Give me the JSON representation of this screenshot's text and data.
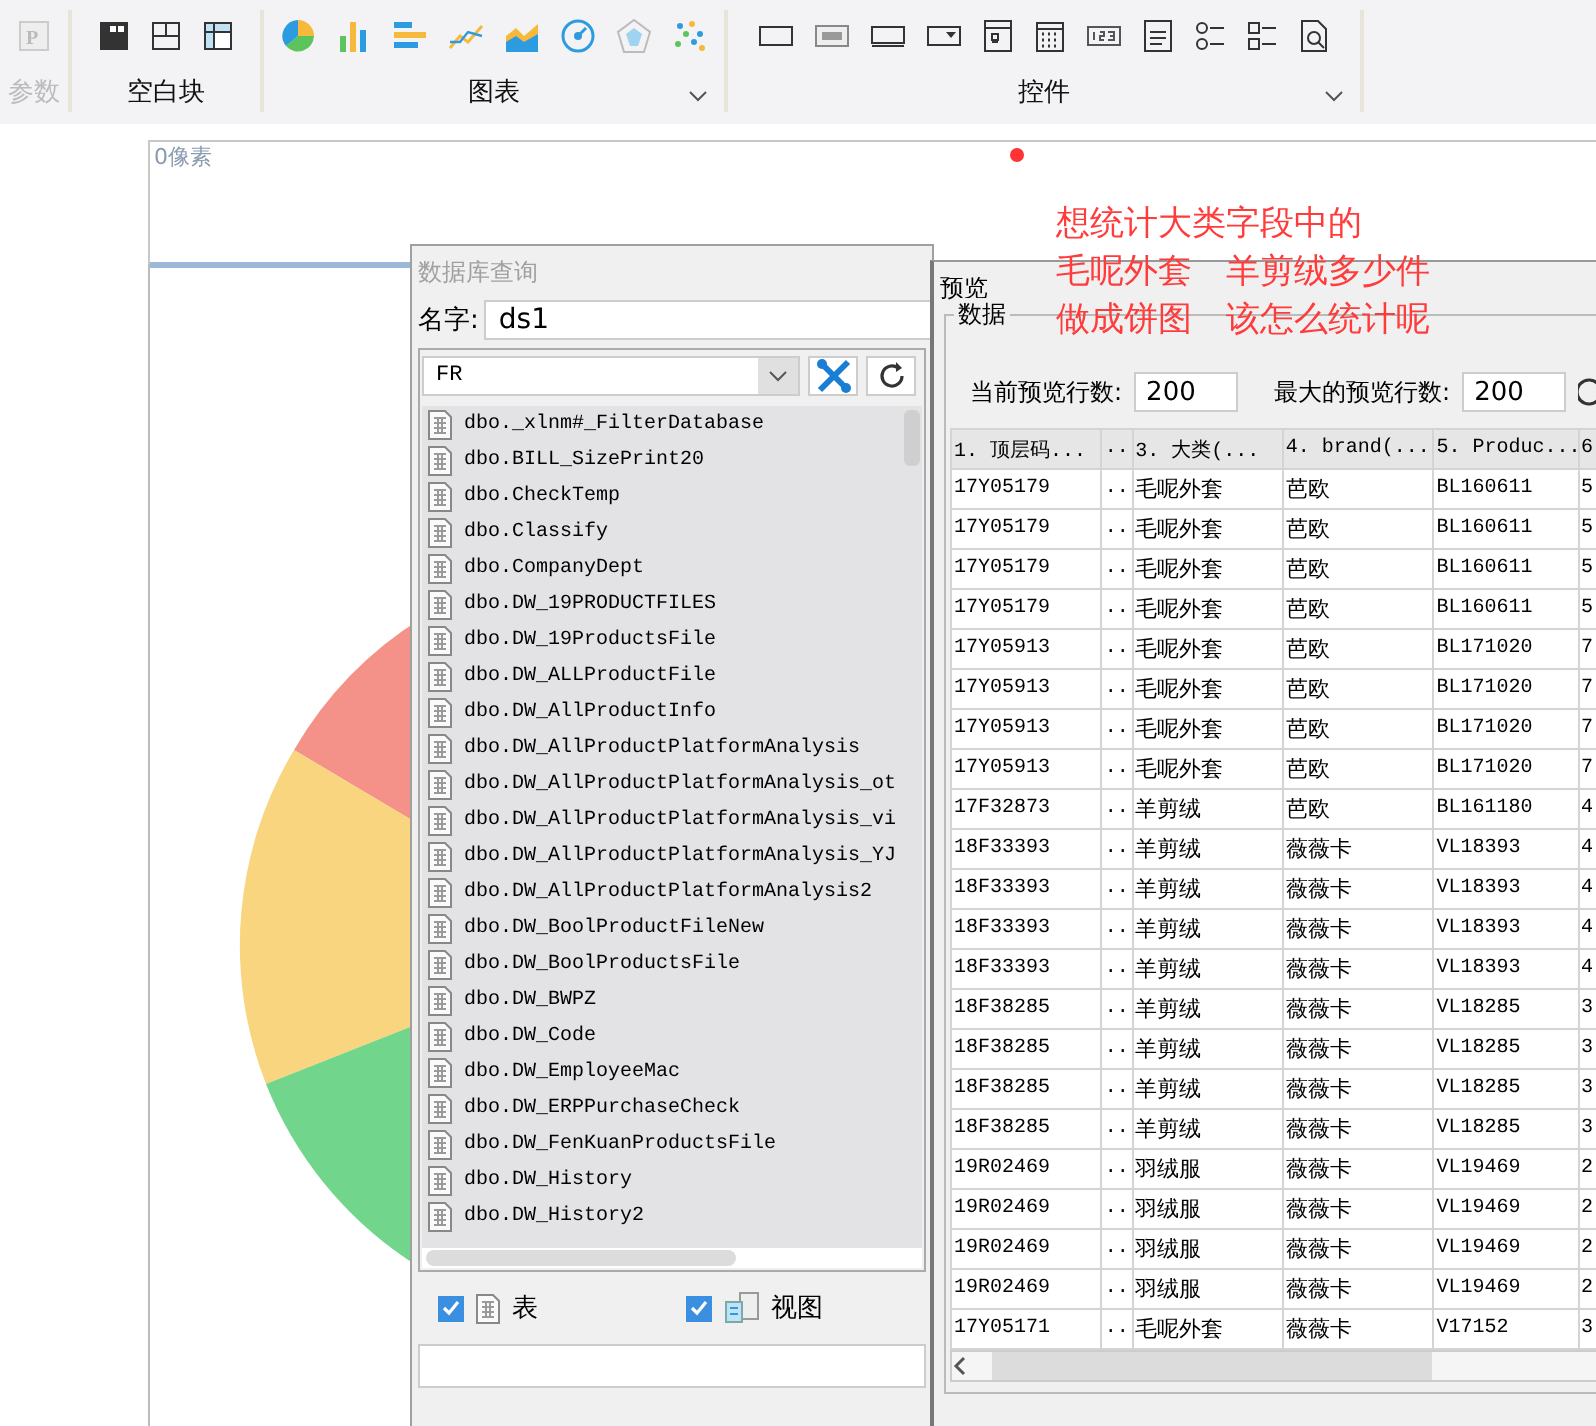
{
  "toolbar": {
    "groups": [
      {
        "label": "参数",
        "disabled": true,
        "dropdown": false,
        "icon_text": "P"
      },
      {
        "label": "空白块",
        "disabled": false,
        "dropdown": false
      },
      {
        "label": "图表",
        "disabled": false,
        "dropdown": true
      },
      {
        "label": "控件",
        "disabled": false,
        "dropdown": true
      }
    ]
  },
  "canvas": {
    "ruler_label": "0像素"
  },
  "annotation": {
    "lines": [
      "想统计大类字段中的",
      "毛呢外套　羊剪绒多少件",
      "做成饼图　该怎么统计呢"
    ]
  },
  "db_dialog": {
    "title": "数据库查询",
    "name_label": "名字:",
    "name_value": "ds1",
    "connection": "FR",
    "tables": [
      "dbo._xlnm#_FilterDatabase",
      "dbo.BILL_SizePrint20",
      "dbo.CheckTemp",
      "dbo.Classify",
      "dbo.CompanyDept",
      "dbo.DW_19PRODUCTFILES",
      "dbo.DW_19ProductsFile",
      "dbo.DW_ALLProductFile",
      "dbo.DW_AllProductInfo",
      "dbo.DW_AllProductPlatformAnalysis",
      "dbo.DW_AllProductPlatformAnalysis_ot",
      "dbo.DW_AllProductPlatformAnalysis_vi",
      "dbo.DW_AllProductPlatformAnalysis_YJ",
      "dbo.DW_AllProductPlatformAnalysis2",
      "dbo.DW_BoolProductFileNew",
      "dbo.DW_BoolProductsFile",
      "dbo.DW_BWPZ",
      "dbo.DW_Code",
      "dbo.DW_EmployeeMac",
      "dbo.DW_ERPPurchaseCheck",
      "dbo.DW_FenKuanProductsFile",
      "dbo.DW_History",
      "dbo.DW_History2"
    ],
    "filters": [
      {
        "label": "表",
        "checked": true,
        "kind": "table"
      },
      {
        "label": "视图",
        "checked": true,
        "kind": "view"
      }
    ]
  },
  "preview": {
    "title": "预览",
    "group_label": "数据",
    "current_rows_label": "当前预览行数:",
    "current_rows": "200",
    "max_rows_label": "最大的预览行数:",
    "max_rows": "200",
    "columns": [
      "1. 顶层码...",
      "..",
      "3. 大类(...",
      "4. brand(...",
      "5. Produc...",
      "6"
    ],
    "rows": [
      [
        "17Y05179",
        "..",
        "毛呢外套",
        "芭欧",
        "BL160611",
        "5"
      ],
      [
        "17Y05179",
        "..",
        "毛呢外套",
        "芭欧",
        "BL160611",
        "5"
      ],
      [
        "17Y05179",
        "..",
        "毛呢外套",
        "芭欧",
        "BL160611",
        "5"
      ],
      [
        "17Y05179",
        "..",
        "毛呢外套",
        "芭欧",
        "BL160611",
        "5"
      ],
      [
        "17Y05913",
        "..",
        "毛呢外套",
        "芭欧",
        "BL171020",
        "7"
      ],
      [
        "17Y05913",
        "..",
        "毛呢外套",
        "芭欧",
        "BL171020",
        "7"
      ],
      [
        "17Y05913",
        "..",
        "毛呢外套",
        "芭欧",
        "BL171020",
        "7"
      ],
      [
        "17Y05913",
        "..",
        "毛呢外套",
        "芭欧",
        "BL171020",
        "7"
      ],
      [
        "17F32873",
        "..",
        "羊剪绒",
        "芭欧",
        "BL161180",
        "4"
      ],
      [
        "18F33393",
        "..",
        "羊剪绒",
        "薇薇卡",
        "VL18393",
        "4"
      ],
      [
        "18F33393",
        "..",
        "羊剪绒",
        "薇薇卡",
        "VL18393",
        "4"
      ],
      [
        "18F33393",
        "..",
        "羊剪绒",
        "薇薇卡",
        "VL18393",
        "4"
      ],
      [
        "18F33393",
        "..",
        "羊剪绒",
        "薇薇卡",
        "VL18393",
        "4"
      ],
      [
        "18F38285",
        "..",
        "羊剪绒",
        "薇薇卡",
        "VL18285",
        "3"
      ],
      [
        "18F38285",
        "..",
        "羊剪绒",
        "薇薇卡",
        "VL18285",
        "3"
      ],
      [
        "18F38285",
        "..",
        "羊剪绒",
        "薇薇卡",
        "VL18285",
        "3"
      ],
      [
        "18F38285",
        "..",
        "羊剪绒",
        "薇薇卡",
        "VL18285",
        "3"
      ],
      [
        "19R02469",
        "..",
        "羽绒服",
        "薇薇卡",
        "VL19469",
        "2"
      ],
      [
        "19R02469",
        "..",
        "羽绒服",
        "薇薇卡",
        "VL19469",
        "2"
      ],
      [
        "19R02469",
        "..",
        "羽绒服",
        "薇薇卡",
        "VL19469",
        "2"
      ],
      [
        "19R02469",
        "..",
        "羽绒服",
        "薇薇卡",
        "VL19469",
        "2"
      ],
      [
        "17Y05171",
        "..",
        "毛呢外套",
        "薇薇卡",
        "V17152",
        "3"
      ]
    ]
  }
}
